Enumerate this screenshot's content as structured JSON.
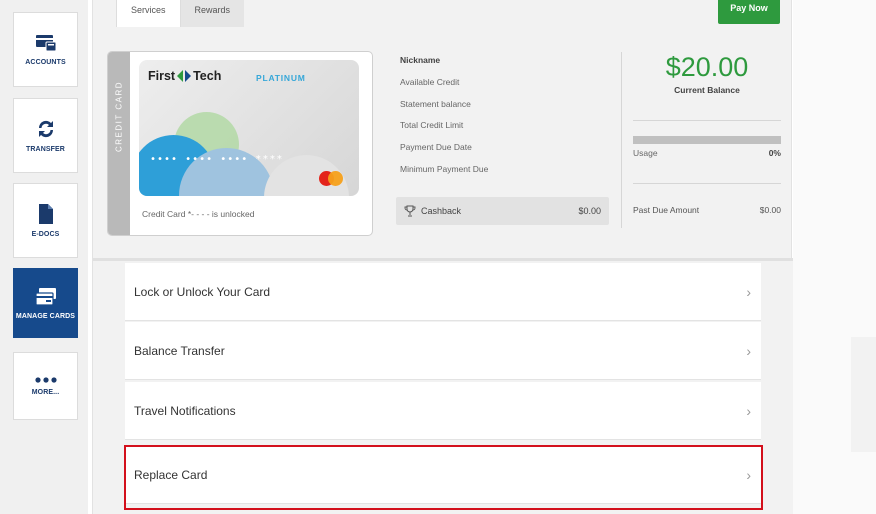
{
  "sidebar": {
    "items": [
      {
        "label": "ACCOUNTS",
        "icon": "accounts-icon"
      },
      {
        "label": "TRANSFER",
        "icon": "transfer-icon"
      },
      {
        "label": "E-DOCS",
        "icon": "document-icon"
      },
      {
        "label": "MANAGE CARDS",
        "icon": "card-icon",
        "active": true
      },
      {
        "label": "MORE...",
        "icon": "more-icon"
      }
    ]
  },
  "tabs": [
    {
      "label": "Services",
      "active": true
    },
    {
      "label": "Rewards",
      "active": false
    }
  ],
  "pay_now_label": "Pay Now",
  "card": {
    "side_label": "CREDIT CARD",
    "brand": "First ",
    "brand_end": "Tech",
    "tier": "PLATINUM",
    "number_mask": "•••• •••• •••• ****",
    "status_text": "Credit Card *- - - - is unlocked"
  },
  "details": {
    "labels": [
      "Nickname",
      "Available Credit",
      "Statement balance",
      "Total Credit Limit",
      "Payment Due Date",
      "Minimum Payment Due"
    ],
    "cashback_label": "Cashback",
    "cashback_value": "$0.00"
  },
  "balance": {
    "amount": "$20.00",
    "label": "Current Balance",
    "usage_label": "Usage",
    "usage_value": "0%",
    "past_due_label": "Past Due Amount",
    "past_due_value": "$0.00"
  },
  "options": [
    "Lock or Unlock Your Card",
    "Balance Transfer",
    "Travel Notifications",
    "Replace Card"
  ],
  "colors": {
    "brand_blue": "#164a8c",
    "accent_green": "#2e9a3e",
    "highlight_red": "#d3101c"
  }
}
